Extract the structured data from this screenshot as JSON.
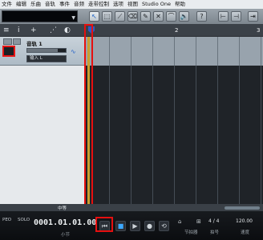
{
  "menu": [
    "文件",
    "编辑",
    "乐曲",
    "音轨",
    "事件",
    "音频",
    "走带控制",
    "选项",
    "视图",
    "Studio One",
    "帮助"
  ],
  "toolbar": {
    "tools": [
      {
        "name": "arrow-tool-icon",
        "glyph": "↖"
      },
      {
        "name": "range-tool-icon",
        "glyph": "⬚"
      },
      {
        "name": "split-tool-icon",
        "glyph": "⟋"
      },
      {
        "name": "eraser-tool-icon",
        "glyph": "⌫"
      },
      {
        "name": "paint-tool-icon",
        "glyph": "✎"
      },
      {
        "name": "mute-tool-icon",
        "glyph": "✕"
      },
      {
        "name": "bend-tool-icon",
        "glyph": "⌒"
      },
      {
        "name": "listen-tool-icon",
        "glyph": "🔈"
      },
      {
        "name": "help-icon",
        "glyph": "?"
      },
      {
        "name": "quantize-icon",
        "glyph": "⊢"
      },
      {
        "name": "snap-icon",
        "glyph": "⊣"
      },
      {
        "name": "toggle-icon",
        "glyph": "⇥"
      }
    ]
  },
  "tracks_header": {
    "icons": [
      {
        "name": "list-icon",
        "glyph": "≡"
      },
      {
        "name": "info-icon",
        "glyph": "i"
      },
      {
        "name": "add-track-icon",
        "glyph": "+"
      },
      {
        "name": "automation-icon",
        "glyph": "⋰"
      },
      {
        "name": "time-icon",
        "glyph": "◐"
      }
    ]
  },
  "track": {
    "name": "音轨 1",
    "input": "输入 L",
    "volume_level": 0.8
  },
  "ruler": {
    "marks": [
      "1",
      "2",
      "3"
    ]
  },
  "arrange_bottom": {
    "left": "PATS",
    "solo": "SOLO",
    "center": "中等"
  },
  "transport": {
    "status": [
      "PEO",
      "SOLO"
    ],
    "time": "0001.01.01.00",
    "time_label": "小节",
    "signature": "4 / 4",
    "signature_label": "拍号",
    "tempo": "120.00",
    "tempo_label": "速度",
    "position_label": "节拍器",
    "extra_label": "格"
  },
  "colors": {
    "highlight": "#e60f0f",
    "accent": "#3da9ff"
  }
}
